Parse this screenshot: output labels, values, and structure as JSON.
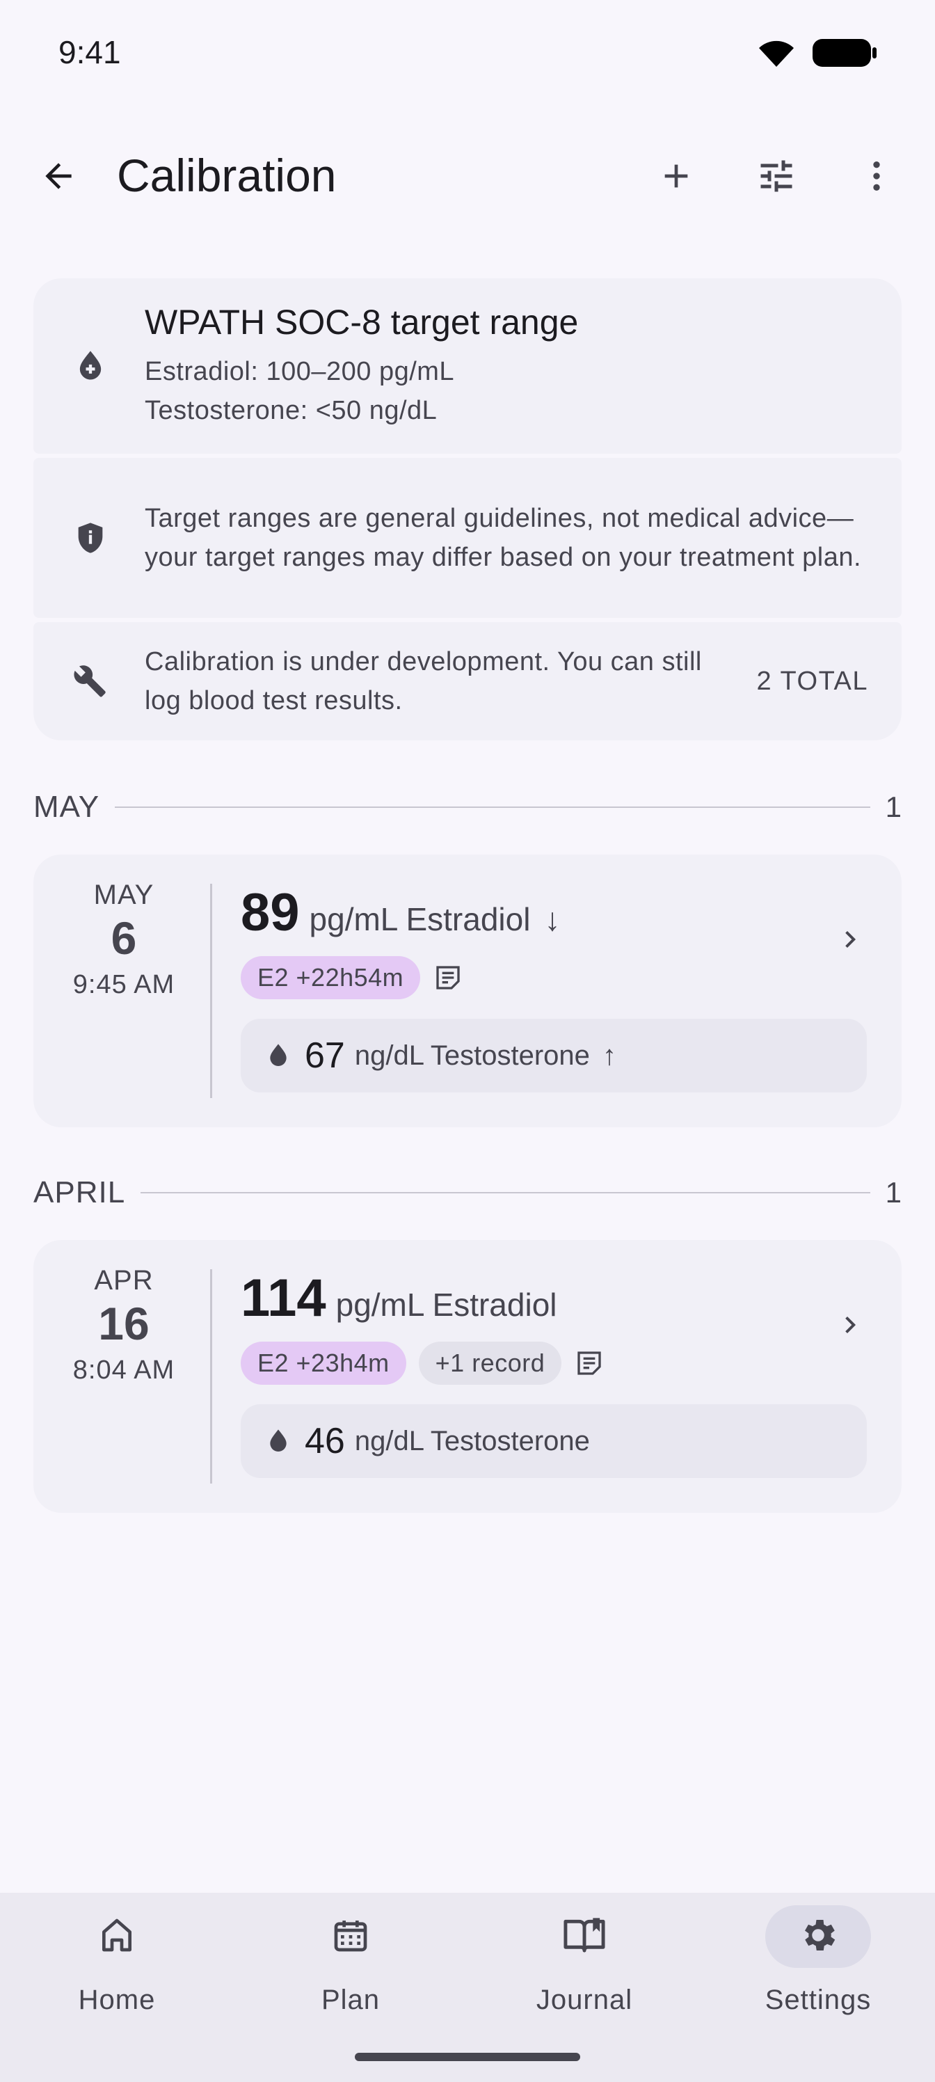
{
  "status_bar": {
    "time": "9:41"
  },
  "app_bar": {
    "title": "Calibration"
  },
  "info": {
    "target_title": "WPATH SOC-8 target range",
    "target_e2": "Estradiol: 100–200 pg/mL",
    "target_t": "Testosterone: <50 ng/dL",
    "disclaimer": "Target ranges are general guidelines, not medical advice—your target ranges may differ based on your treatment plan.",
    "dev_note": "Calibration is under development. You can still log blood test results.",
    "total": "2 TOTAL"
  },
  "sections": [
    {
      "label": "MAY",
      "count": "1",
      "entry": {
        "month": "MAY",
        "day": "6",
        "time": "9:45 AM",
        "main_value": "89",
        "main_unit": "pg/mL Estradiol",
        "main_trend": "↓",
        "chips": [
          "E2 +22h54m"
        ],
        "sub_value": "67",
        "sub_unit": "ng/dL Testosterone",
        "sub_trend": "↑"
      }
    },
    {
      "label": "APRIL",
      "count": "1",
      "entry": {
        "month": "APR",
        "day": "16",
        "time": "8:04 AM",
        "main_value": "114",
        "main_unit": "pg/mL Estradiol",
        "main_trend": "",
        "chips": [
          "E2 +23h4m",
          "+1 record"
        ],
        "sub_value": "46",
        "sub_unit": "ng/dL Testosterone",
        "sub_trend": ""
      }
    }
  ],
  "nav": {
    "items": [
      {
        "label": "Home",
        "icon": "home-icon"
      },
      {
        "label": "Plan",
        "icon": "calendar-icon"
      },
      {
        "label": "Journal",
        "icon": "book-icon"
      },
      {
        "label": "Settings",
        "icon": "gear-icon"
      }
    ],
    "active": "Settings"
  },
  "colors": {
    "background": "#f8f6fc",
    "card": "#f1f0f7",
    "chip_purple": "#e4c9f5",
    "chip_grey": "#e3e2eb",
    "text_primary": "#1c1b20",
    "text_secondary": "#46454f"
  }
}
